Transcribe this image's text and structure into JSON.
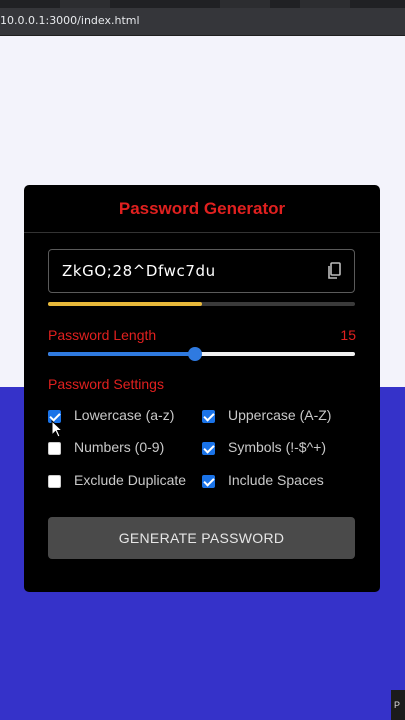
{
  "browser": {
    "url": "10.0.0.1:3000/index.html"
  },
  "app": {
    "title": "Password Generator",
    "password": "ZkGO;28^Dfwc7du",
    "strength_fraction": 0.5,
    "length_label": "Password Length",
    "length_value": "15",
    "length_slider_fraction": 0.48,
    "settings_label": "Password Settings",
    "options": [
      {
        "label": "Lowercase (a-z)",
        "checked": true
      },
      {
        "label": "Uppercase (A-Z)",
        "checked": true
      },
      {
        "label": "Numbers (0-9)",
        "checked": false
      },
      {
        "label": "Symbols (!-$^+)",
        "checked": true
      },
      {
        "label": "Exclude Duplicate",
        "checked": false
      },
      {
        "label": "Include Spaces",
        "checked": true
      }
    ],
    "generate_label": "GENERATE PASSWORD"
  },
  "colors": {
    "accent_red": "#e0201f",
    "slider_blue": "#2f7ae0",
    "strength_yellow": "#e8b93a",
    "bg_blue": "#3532c9"
  },
  "corner_badge": "P"
}
